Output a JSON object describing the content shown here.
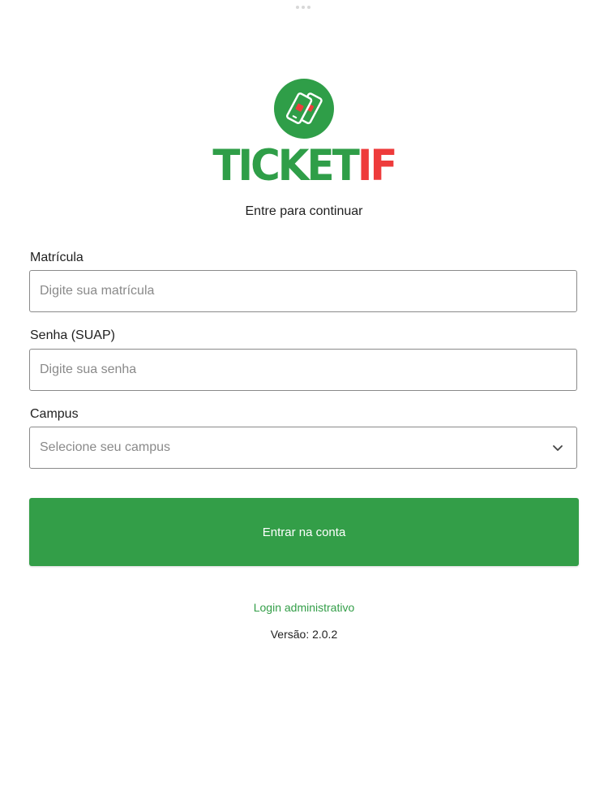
{
  "brand": {
    "name_part1": "TICKET",
    "name_part2": "IF",
    "primary_color": "#339e48",
    "accent_color": "#ee3b3b"
  },
  "subtitle": "Entre para continuar",
  "form": {
    "matricula": {
      "label": "Matrícula",
      "placeholder": "Digite sua matrícula",
      "value": ""
    },
    "senha": {
      "label": "Senha (SUAP)",
      "placeholder": "Digite sua senha",
      "value": ""
    },
    "campus": {
      "label": "Campus",
      "selected": "Selecione seu campus",
      "icon": "chevron-down-icon"
    }
  },
  "submit_label": "Entrar na conta",
  "admin_link": "Login administrativo",
  "version": "Versão: 2.0.2"
}
